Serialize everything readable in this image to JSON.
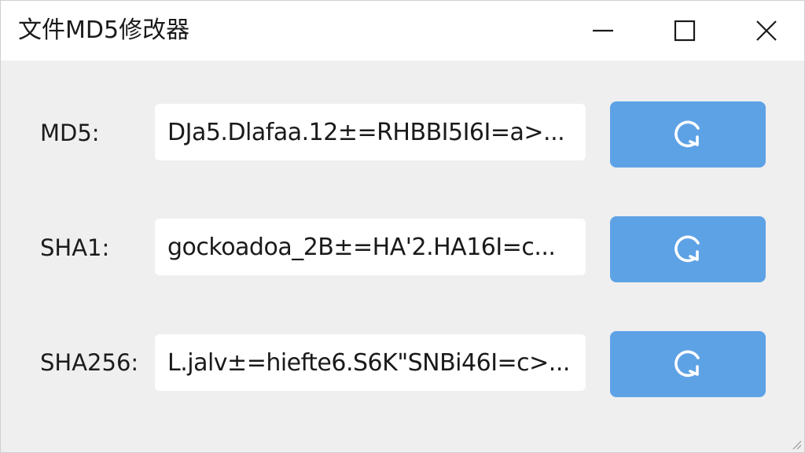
{
  "window": {
    "title": "文件MD5修改器"
  },
  "icons": {
    "minimize": "minimize-icon",
    "maximize": "maximize-icon",
    "close": "close-icon",
    "refresh": "refresh-icon",
    "resize": "resize-grip-icon"
  },
  "colors": {
    "accent": "#5ea2e6",
    "background": "#efefef",
    "titlebar": "#ffffff"
  },
  "rows": [
    {
      "label": "MD5:",
      "value": "DJa5.Dlafaa.12±=RHBBI5I6I=a>..."
    },
    {
      "label": "SHA1:",
      "value": "gockoadoa_2B±=HA'2.HA16I=c..."
    },
    {
      "label": "SHA256:",
      "value": "L.jalv±=hiefte6.S6K\"SNBi46I=c>..."
    }
  ]
}
